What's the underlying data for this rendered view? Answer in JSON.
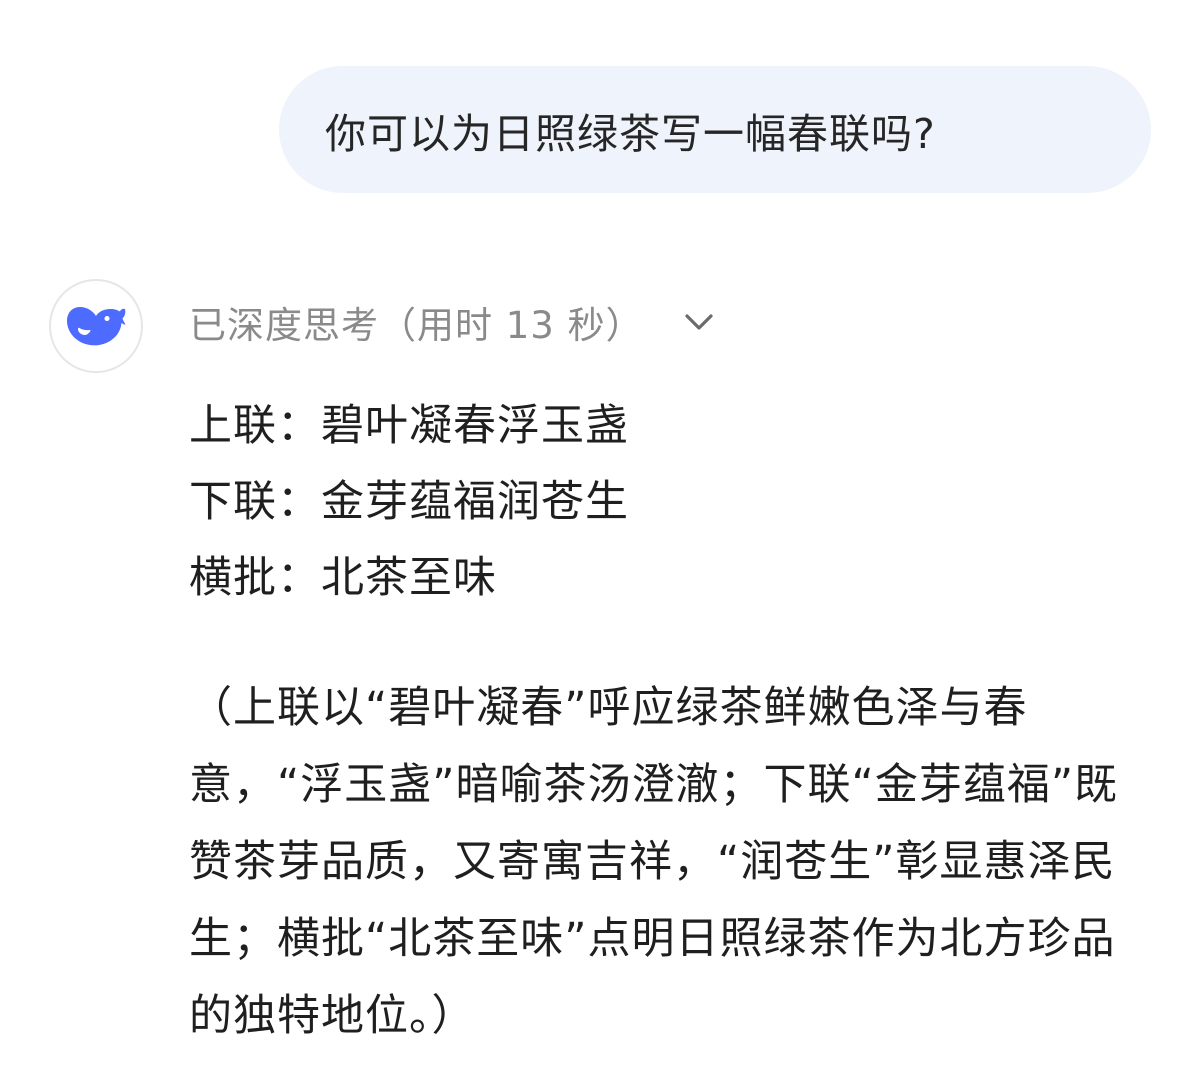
{
  "user_message": {
    "text": "你可以为日照绿茶写一幅春联吗?"
  },
  "assistant": {
    "avatar_icon": "deepseek-whale-icon",
    "accent_color": "#4d6bfe",
    "thinking_label": "已深度思考（用时 13 秒）",
    "expand_icon": "chevron-down-icon",
    "couplet": [
      "上联：碧叶凝春浮玉盏",
      "下联：金芽蕴福润苍生",
      "横批：北茶至味"
    ],
    "explanation": "（上联以“碧叶凝春”呼应绿茶鲜嫩色泽与春意，“浮玉盏”暗喻茶汤澄澈；下联“金芽蕴福”既赞茶芽品质，又寄寓吉祥，“润苍生”彰显惠泽民生；横批“北茶至味”点明日照绿茶作为北方珍品的独特地位。）"
  }
}
